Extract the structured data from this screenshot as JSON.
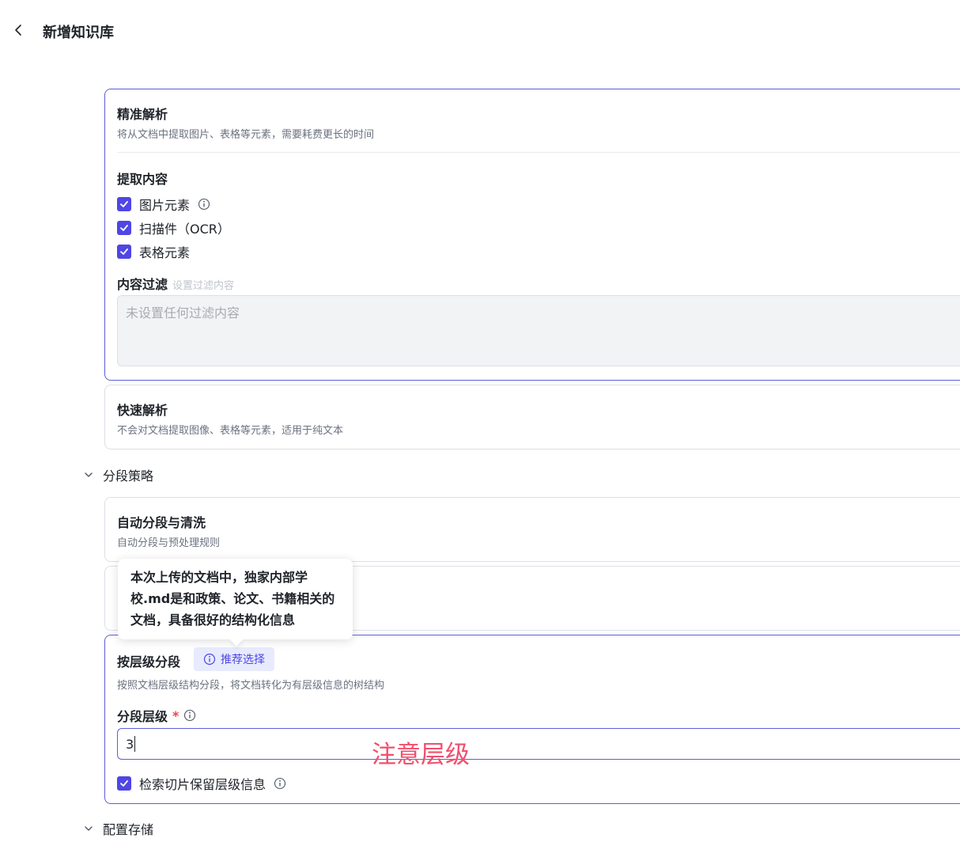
{
  "header": {
    "title": "新增知识库"
  },
  "precise": {
    "title": "精准解析",
    "desc": "将从文档中提取图片、表格等元素，需要耗费更长的时间",
    "extract_label": "提取内容",
    "options": [
      {
        "label": "图片元素",
        "checked": true
      },
      {
        "label": "扫描件（OCR）",
        "checked": true
      },
      {
        "label": "表格元素",
        "checked": true
      }
    ],
    "filter_label": "内容过滤",
    "filter_hint": "设置过滤内容",
    "filter_placeholder": "未设置任何过滤内容"
  },
  "fast": {
    "title": "快速解析",
    "desc": "不会对文档提取图像、表格等元素，适用于纯文本"
  },
  "segmentation": {
    "section_label": "分段策略",
    "auto": {
      "title": "自动分段与清洗",
      "desc": "自动分段与预处理规则"
    },
    "tooltip": "本次上传的文档中，独家内部学校.md是和政策、论文、书籍相关的文档，具备很好的结构化信息",
    "hierarchy": {
      "title": "按层级分段",
      "badge": "推荐选择",
      "desc": "按照文档层级结构分段，将文档转化为有层级信息的树结构",
      "level_label": "分段层级",
      "required_mark": "*",
      "level_value": "3",
      "keep_info_label": "检索切片保留层级信息",
      "keep_info_checked": true
    }
  },
  "storage": {
    "section_label": "配置存储"
  },
  "annotation": "注意层级",
  "colors": {
    "accent": "#4f46e5",
    "annotation": "#f0506e"
  }
}
